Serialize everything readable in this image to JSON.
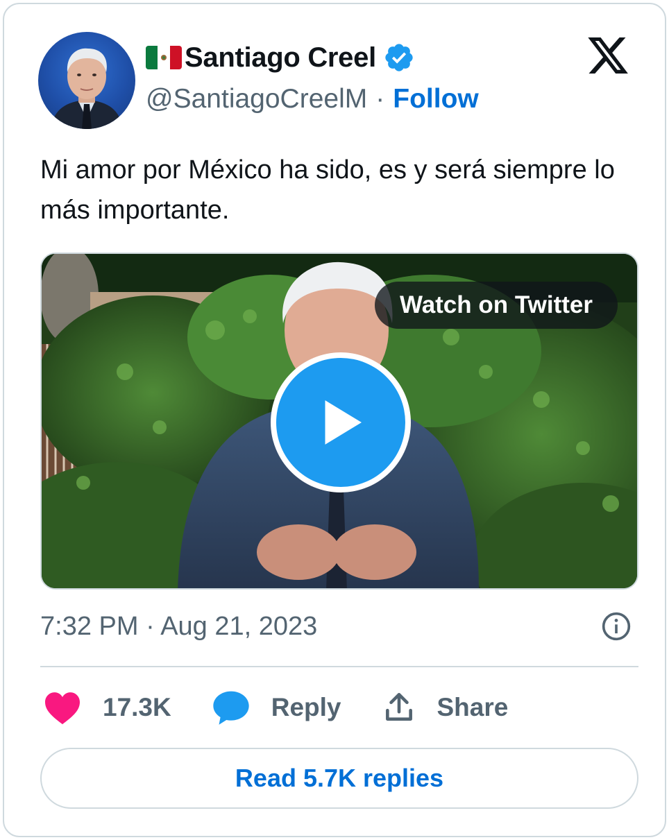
{
  "tweet": {
    "author_name": "Santiago Creel",
    "handle": "@SantiagoCreelM",
    "separator": "·",
    "follow_label": "Follow",
    "text": "Mi amor por México ha sido, es y será siempre lo más importante.",
    "media": {
      "watch_label": "Watch on Twitter"
    },
    "timestamp": "7:32 PM · Aug 21, 2023",
    "likes_count": "17.3K",
    "reply_label": "Reply",
    "share_label": "Share",
    "read_replies_label": "Read 5.7K replies"
  },
  "icons": {
    "flag": "mexico-flag-icon",
    "verified": "verified-badge-icon",
    "logo": "x-logo-icon",
    "play": "play-icon",
    "info": "info-icon",
    "like": "heart-icon",
    "reply": "speech-bubble-icon",
    "share": "share-upload-icon"
  },
  "colors": {
    "text_primary": "#0f1419",
    "text_secondary": "#536471",
    "link": "#006fd6",
    "accent_blue": "#1d9bf0",
    "heart": "#f91880",
    "border": "#cfd9de"
  }
}
